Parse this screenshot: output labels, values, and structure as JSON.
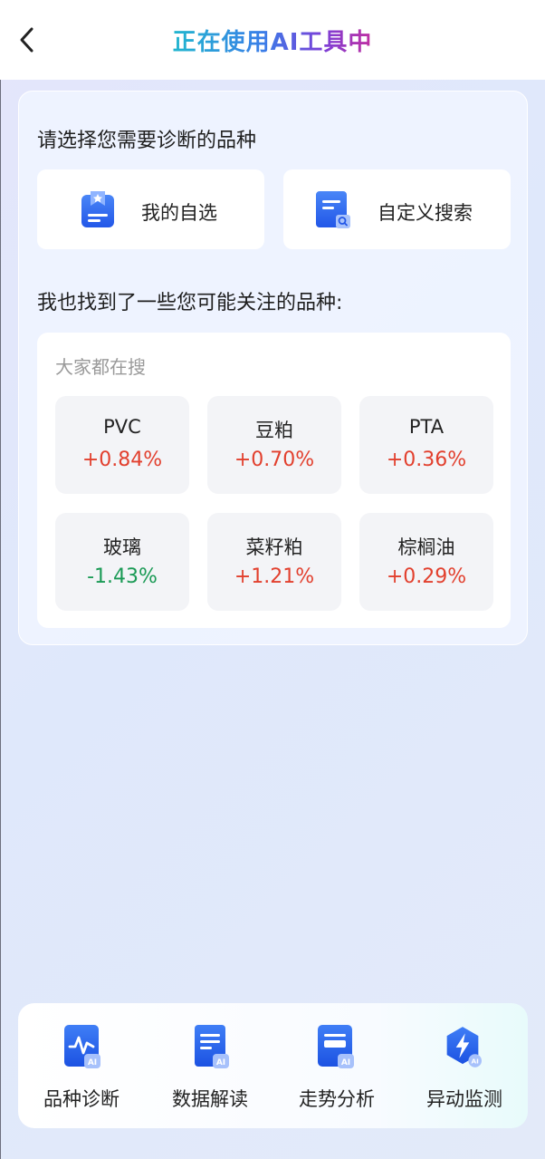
{
  "header": {
    "title": "正在使用AI工具中",
    "back_icon": "chevron-left-icon"
  },
  "choose": {
    "title": "请选择您需要诊断的品种",
    "options": [
      {
        "label": "我的自选",
        "icon": "favorites-list-icon"
      },
      {
        "label": "自定义搜索",
        "icon": "document-search-icon"
      }
    ]
  },
  "suggest": {
    "title": "我也找到了一些您可能关注的品种:",
    "hot_title": "大家都在搜",
    "items": [
      {
        "name": "PVC",
        "change": "+0.84%",
        "direction": "up"
      },
      {
        "name": "豆粕",
        "change": "+0.70%",
        "direction": "up"
      },
      {
        "name": "PTA",
        "change": "+0.36%",
        "direction": "up"
      },
      {
        "name": "玻璃",
        "change": "-1.43%",
        "direction": "down"
      },
      {
        "name": "菜籽粕",
        "change": "+1.21%",
        "direction": "up"
      },
      {
        "name": "棕榈油",
        "change": "+0.29%",
        "direction": "up"
      }
    ]
  },
  "tools": [
    {
      "label": "品种诊断",
      "icon": "pulse-ai-icon"
    },
    {
      "label": "数据解读",
      "icon": "document-ai-icon"
    },
    {
      "label": "走势分析",
      "icon": "card-ai-icon"
    },
    {
      "label": "异动监测",
      "icon": "lightning-ai-icon"
    }
  ],
  "colors": {
    "up": "#e2402e",
    "down": "#1a9a55",
    "accent_blue": "#2f6ff0"
  }
}
